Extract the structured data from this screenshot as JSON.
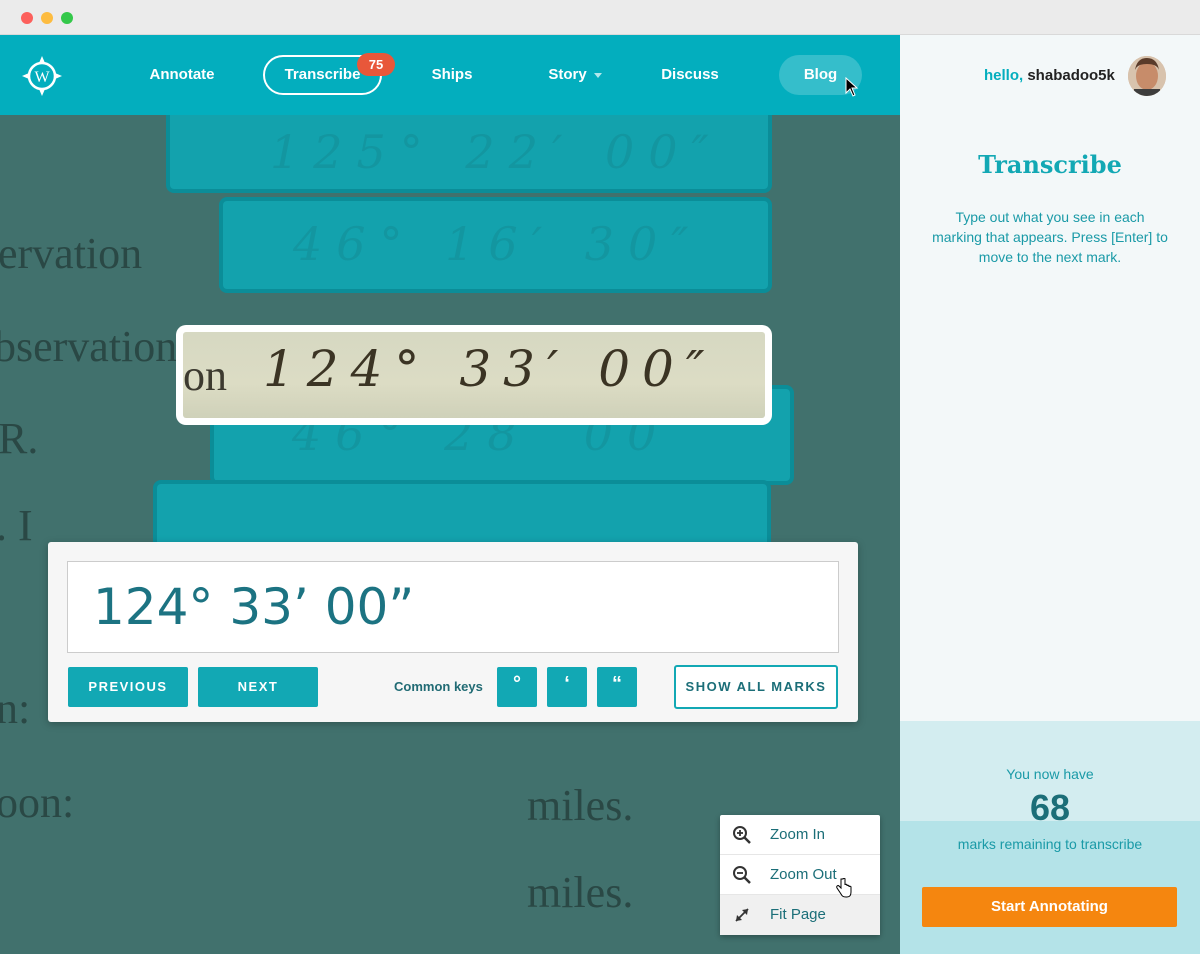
{
  "nav": {
    "annotate": "Annotate",
    "transcribe": "Transcribe",
    "transcribe_badge": "75",
    "ships": "Ships",
    "story": "Story",
    "discuss": "Discuss",
    "blog": "Blog"
  },
  "user": {
    "hello": "hello,",
    "name": "shabadoo5k"
  },
  "document": {
    "scan_lines": [
      "ervation",
      "bservation",
      "R.",
      ". I",
      "n:",
      "oon:",
      "miles.",
      "miles."
    ],
    "marks": [
      "125° 22′ 00″",
      "46° 16′ 30″",
      "46° 28′ 00″"
    ],
    "active_mark_serif": "on",
    "active_mark_handwriting": "124° 33′ 00″"
  },
  "panel": {
    "input_value": "124° 33’ 00”",
    "previous": "PREVIOUS",
    "next": "NEXT",
    "common_keys_label": "Common keys",
    "keys": [
      "°",
      "‘",
      "“"
    ],
    "show_all_marks": "SHOW ALL MARKS"
  },
  "zoom_menu": {
    "zoom_in": "Zoom In",
    "zoom_out": "Zoom Out",
    "fit_page": "Fit Page"
  },
  "sidebar": {
    "title": "Transcribe",
    "description": "Type out what you see in each marking that appears. Press [Enter] to move to the next mark.",
    "you_now_have": "You now have",
    "count": "68",
    "marks_remaining": "marks remaining to transcribe",
    "start_button": "Start Annotating"
  },
  "colors": {
    "brand_teal": "#03aebe",
    "button_teal": "#12a8b4",
    "badge_red": "#e8573a",
    "cta_orange": "#f5860f",
    "dark_teal_text": "#1b6e78"
  },
  "icons": [
    "logo-compass-icon",
    "caret-down-icon",
    "zoom-in-icon",
    "zoom-out-icon",
    "fit-page-icon",
    "mouse-pointer-icon",
    "hand-pointer-icon"
  ]
}
